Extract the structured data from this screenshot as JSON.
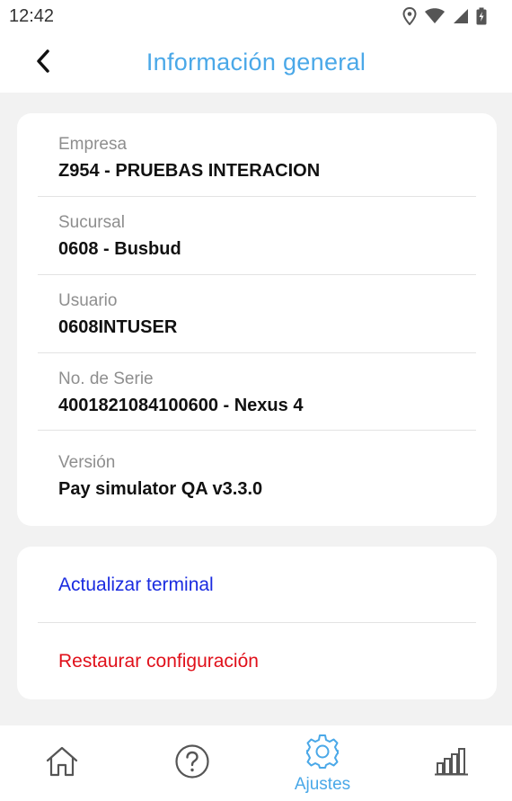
{
  "status_bar": {
    "time": "12:42",
    "icons": [
      "location-icon",
      "wifi-icon",
      "signal-icon",
      "battery-charging-icon"
    ]
  },
  "header": {
    "back_icon": "chevron-left-icon",
    "title": "Información general"
  },
  "info": {
    "rows": [
      {
        "label": "Empresa",
        "value": "Z954 - PRUEBAS INTERACION"
      },
      {
        "label": "Sucursal",
        "value": "0608 - Busbud"
      },
      {
        "label": "Usuario",
        "value": "0608INTUSER"
      },
      {
        "label": "No. de Serie",
        "value": "4001821084100600 - Nexus 4"
      },
      {
        "label": "Versión",
        "value": "Pay simulator QA v3.3.0"
      }
    ]
  },
  "actions": {
    "update_terminal": "Actualizar terminal",
    "restore_config": "Restaurar configuración"
  },
  "bottom_nav": {
    "items": [
      {
        "icon": "home-icon",
        "label": ""
      },
      {
        "icon": "help-icon",
        "label": ""
      },
      {
        "icon": "settings-gear-icon",
        "label": "Ajustes",
        "active": true
      },
      {
        "icon": "bar-chart-icon",
        "label": ""
      }
    ]
  },
  "colors": {
    "accent": "#4aa8e8",
    "action_blue": "#1a2be0",
    "action_red": "#e0101a",
    "background": "#f2f2f2"
  }
}
